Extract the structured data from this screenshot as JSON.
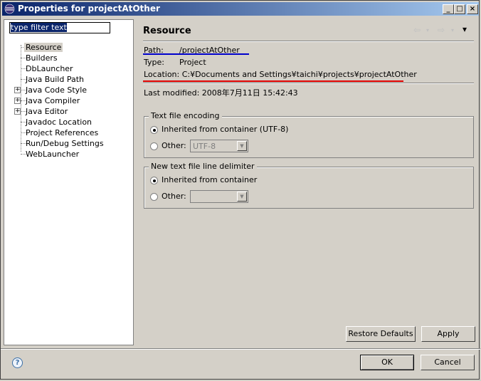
{
  "window": {
    "title": "Properties for projectAtOther"
  },
  "filter": {
    "value": "type filter text"
  },
  "tree": {
    "items": [
      {
        "label": "Resource",
        "expandable": false
      },
      {
        "label": "Builders",
        "expandable": false
      },
      {
        "label": "DbLauncher",
        "expandable": false
      },
      {
        "label": "Java Build Path",
        "expandable": false
      },
      {
        "label": "Java Code Style",
        "expandable": true
      },
      {
        "label": "Java Compiler",
        "expandable": true
      },
      {
        "label": "Java Editor",
        "expandable": true
      },
      {
        "label": "Javadoc Location",
        "expandable": false
      },
      {
        "label": "Project References",
        "expandable": false
      },
      {
        "label": "Run/Debug Settings",
        "expandable": false
      },
      {
        "label": "WebLauncher",
        "expandable": false
      }
    ],
    "expand_glyph": "+"
  },
  "page": {
    "title": "Resource",
    "nav": {
      "back": "⇦",
      "forward": "⇨",
      "menu": "▾"
    },
    "path": {
      "label": "Path:",
      "value": "/projectAtOther"
    },
    "type": {
      "label": "Type:",
      "value": "Project"
    },
    "location": {
      "label": "Location:",
      "value": "C:¥Documents and Settings¥taichi¥projects¥projectAtOther"
    },
    "last_modified": {
      "label": "Last modified:",
      "value": "2008年7月11日 15:42:43"
    }
  },
  "encoding": {
    "title": "Text file encoding",
    "inherited_label": "Inherited from container (UTF-8)",
    "other_label": "Other:",
    "other_value": "UTF-8"
  },
  "delimiter": {
    "title": "New text file line delimiter",
    "inherited_label": "Inherited from container",
    "other_label": "Other:",
    "other_value": ""
  },
  "buttons": {
    "restore_defaults": "Restore Defaults",
    "apply": "Apply",
    "ok": "OK",
    "cancel": "Cancel",
    "help": "?"
  },
  "titlebar_buttons": {
    "minimize": "_",
    "maximize": "□",
    "close": "×"
  },
  "colors": {
    "path_underline": "#0000cc",
    "location_underline": "#dd0000",
    "title_gradient_start": "#0a246a"
  }
}
